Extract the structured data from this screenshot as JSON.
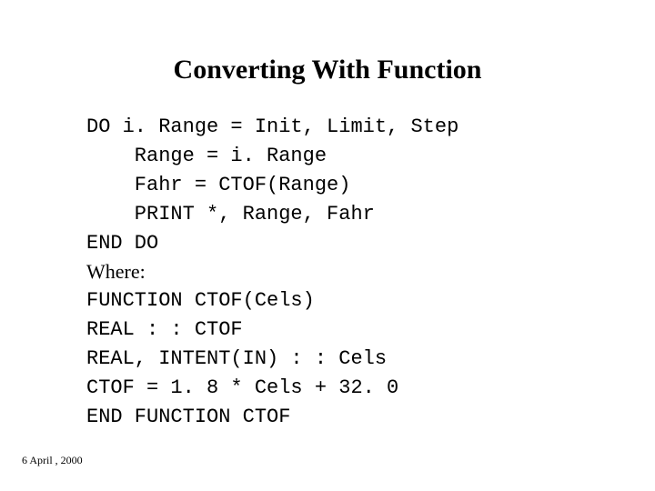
{
  "title": "Converting With Function",
  "lines": {
    "l1": "DO i. Range = Init, Limit, Step",
    "l2": "    Range = i. Range",
    "l3": "    Fahr = CTOF(Range)",
    "l4": "    PRINT *, Range, Fahr",
    "l5": "END DO",
    "l6": "Where:",
    "l7": "FUNCTION CTOF(Cels)",
    "l8": "REAL : : CTOF",
    "l9": "REAL, INTENT(IN) : : Cels",
    "l10": "CTOF = 1. 8 * Cels + 32. 0",
    "l11": "END FUNCTION CTOF"
  },
  "footer": "6 April , 2000"
}
